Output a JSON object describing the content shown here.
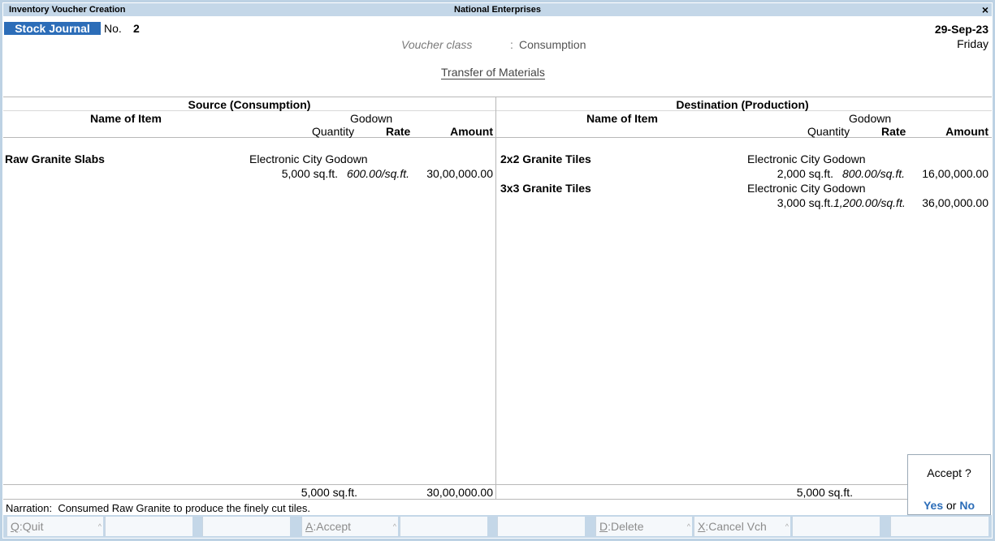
{
  "window": {
    "title": "Inventory Voucher Creation",
    "company": "National Enterprises",
    "close_glyph": "×"
  },
  "voucher": {
    "type": "Stock Journal",
    "no_label": "No.",
    "no": "2",
    "date": "29-Sep-23",
    "day": "Friday",
    "class_label": "Voucher class",
    "class_colon": ":",
    "class_value": "Consumption",
    "heading": "Transfer of Materials"
  },
  "columns": {
    "name": "Name of Item",
    "godown": "Godown",
    "quantity": "Quantity",
    "rate": "Rate",
    "amount": "Amount"
  },
  "source": {
    "title": "Source (Consumption)",
    "items": [
      {
        "name": "Raw Granite Slabs",
        "godown": "Electronic City Godown",
        "qty": "5,000 sq.ft.",
        "rate": "600.00/sq.ft.",
        "amount": "30,00,000.00"
      }
    ],
    "total_qty": "5,000 sq.ft.",
    "total_amount": "30,00,000.00"
  },
  "destination": {
    "title": "Destination (Production)",
    "items": [
      {
        "name": "2x2 Granite Tiles",
        "godown": "Electronic City Godown",
        "qty": "2,000 sq.ft.",
        "rate": "800.00/sq.ft.",
        "amount": "16,00,000.00"
      },
      {
        "name": "3x3 Granite Tiles",
        "godown": "Electronic City Godown",
        "qty": "3,000 sq.ft.",
        "rate": "1,200.00/sq.ft.",
        "amount": "36,00,000.00"
      }
    ],
    "total_qty": "5,000 sq.ft."
  },
  "narration": {
    "label": "Narration:",
    "text": "Consumed Raw Granite to produce the finely cut tiles."
  },
  "accept_dialog": {
    "question": "Accept ?",
    "yes": "Yes",
    "or": "or",
    "no": "No"
  },
  "buttons": {
    "quit": {
      "key": "Q",
      "label": "Quit"
    },
    "accept": {
      "key": "A",
      "label": "Accept"
    },
    "delete": {
      "key": "D",
      "label": "Delete"
    },
    "cancel": {
      "key": "X",
      "label": "Cancel Vch"
    },
    "sep": "^"
  }
}
